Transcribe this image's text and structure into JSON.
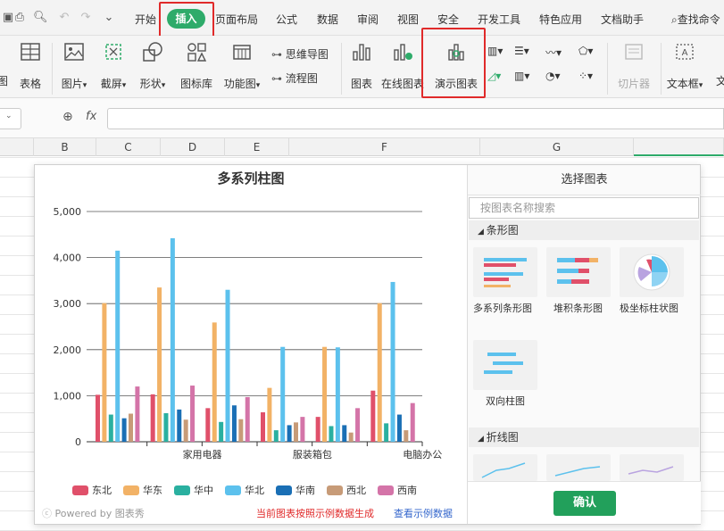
{
  "menubar": {
    "items": [
      "开始",
      "插入",
      "页面布局",
      "公式",
      "数据",
      "审阅",
      "视图",
      "安全",
      "开发工具",
      "特色应用",
      "文档助手"
    ],
    "active": "插入",
    "search_label": "查找命令"
  },
  "ribbon": {
    "left_partial": "图",
    "table": "表格",
    "picture": "图片",
    "screenshot": "截屏",
    "shape": "形状",
    "icon_lib": "图标库",
    "func_chart": "功能图",
    "mindmap": "思维导图",
    "flowchart": "流程图",
    "chart": "图表",
    "online_chart": "在线图表",
    "demo_chart": "演示图表",
    "slicer": "切片器",
    "textbox": "文本框",
    "right_partial": "文"
  },
  "formula": {
    "fx_label": "fx"
  },
  "columns": [
    "B",
    "C",
    "D",
    "E",
    "F",
    "G"
  ],
  "dialog": {
    "right_title": "选择图表",
    "search_placeholder": "按图表名称搜索",
    "section_bar": "条形图",
    "section_line": "折线图",
    "thumbs": [
      "多系列条形图",
      "堆积条形图",
      "极坐标柱状图",
      "双向柱图"
    ],
    "confirm": "确认",
    "footer_powered": "Powered by 图表秀",
    "footer_warning": "当前图表按照示例数据生成",
    "footer_link": "查看示例数据"
  },
  "chart_data": {
    "type": "bar",
    "title": "多系列柱图",
    "categories": [
      "",
      "家用电器",
      "",
      "服装箱包",
      "",
      "电脑办公"
    ],
    "ylim": [
      0,
      5000
    ],
    "yticks": [
      "0",
      "1,000",
      "2,000",
      "3,000",
      "4,000",
      "5,000"
    ],
    "grid": true,
    "legend_position": "bottom",
    "series": [
      {
        "name": "东北",
        "color": "#e0506a",
        "values": [
          1020,
          1030,
          730,
          640,
          540,
          1110
        ]
      },
      {
        "name": "华东",
        "color": "#f2b266",
        "values": [
          3010,
          3350,
          2590,
          1170,
          2060,
          3010
        ]
      },
      {
        "name": "华中",
        "color": "#2ab0a0",
        "values": [
          590,
          620,
          430,
          250,
          340,
          400
        ]
      },
      {
        "name": "华北",
        "color": "#5cc1ed",
        "values": [
          4150,
          4420,
          3300,
          2060,
          2050,
          3470
        ]
      },
      {
        "name": "华南",
        "color": "#1a6fb5",
        "values": [
          510,
          700,
          790,
          360,
          360,
          590
        ]
      },
      {
        "name": "西北",
        "color": "#c79b78",
        "values": [
          610,
          480,
          490,
          420,
          200,
          250
        ]
      },
      {
        "name": "西南",
        "color": "#d474a8",
        "values": [
          1200,
          1220,
          970,
          540,
          730,
          840
        ]
      }
    ]
  }
}
